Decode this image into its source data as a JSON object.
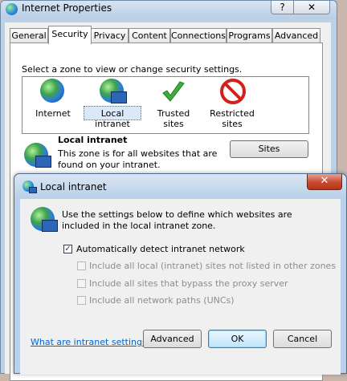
{
  "internet_properties": {
    "title": "Internet Properties",
    "help_label": "?",
    "close_label": "✕",
    "tabs": [
      {
        "label": "General"
      },
      {
        "label": "Security"
      },
      {
        "label": "Privacy"
      },
      {
        "label": "Content"
      },
      {
        "label": "Connections"
      },
      {
        "label": "Programs"
      },
      {
        "label": "Advanced"
      }
    ],
    "active_tab": "Security",
    "zone_instruction": "Select a zone to view or change security settings.",
    "zones": [
      {
        "label": "Internet",
        "icon": "globe-icon"
      },
      {
        "label": "Local intranet",
        "icon": "local-intranet-icon"
      },
      {
        "label": "Trusted sites",
        "icon": "checkmark-icon"
      },
      {
        "label": "Restricted sites",
        "icon": "restricted-icon"
      }
    ],
    "selected_zone": "Local intranet",
    "zone_heading": "Local intranet",
    "zone_description": "This zone is for all websites that are found on your intranet.",
    "sites_button": "Sites"
  },
  "local_intranet_dialog": {
    "title": "Local intranet",
    "close_label": "✕",
    "info_text": "Use the settings below to define which websites are included in the local intranet zone.",
    "checkboxes": [
      {
        "label": "Automatically detect intranet network",
        "checked": true,
        "enabled": true
      },
      {
        "label": "Include all local (intranet) sites not listed in other zones",
        "checked": false,
        "enabled": false
      },
      {
        "label": "Include all sites that bypass the proxy server",
        "checked": false,
        "enabled": false
      },
      {
        "label": "Include all network paths (UNCs)",
        "checked": false,
        "enabled": false
      }
    ],
    "help_link": "What are intranet settings?",
    "buttons": {
      "advanced": "Advanced",
      "ok": "OK",
      "cancel": "Cancel"
    }
  },
  "colors": {
    "link": "#0066cc",
    "disabled_text": "#8d8d8d",
    "close_button": "#c74a30"
  }
}
